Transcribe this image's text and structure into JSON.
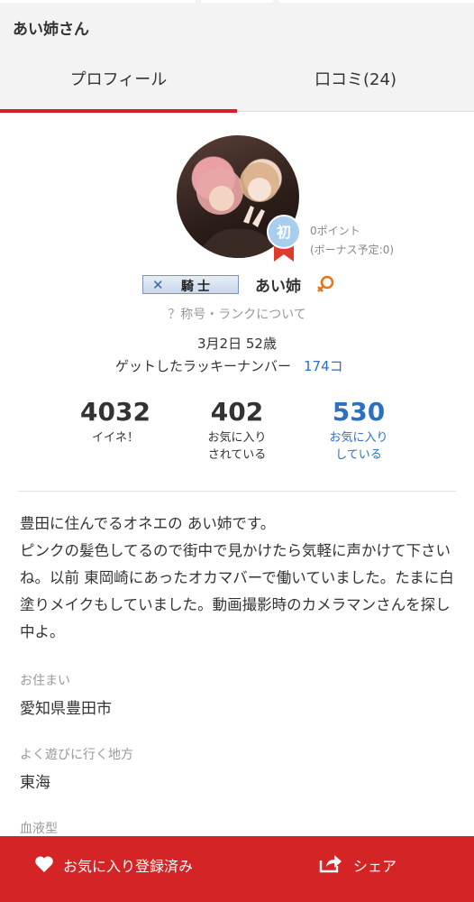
{
  "header": {
    "title": "あい姉さん"
  },
  "tabs": [
    {
      "label": "プロフィール",
      "active": true
    },
    {
      "label": "口コミ(24)",
      "active": false
    }
  ],
  "profile": {
    "beginner_badge": "初",
    "points_line1": "0ポイント",
    "points_line2": "(ボーナス予定:0)",
    "rank_label": "騎士",
    "nickname": "あい姉",
    "gender_icon": "female-icon",
    "rank_help": "？称号・ランクについて",
    "birth_age": "3月2日 52歳",
    "lucky_label": "ゲットしたラッキーナンバー",
    "lucky_value": "174コ"
  },
  "stats": [
    {
      "value": "4032",
      "label_line1": "イイネ！",
      "label_line2": ""
    },
    {
      "value": "402",
      "label_line1": "お気に入り",
      "label_line2": "されている"
    },
    {
      "value": "530",
      "label_line1": "お気に入り",
      "label_line2": "している"
    }
  ],
  "bio": {
    "line1": "豊田に住んでるオネエの あい姉です。",
    "line2": "ピンクの髪色してるので街中で見かけたら気軽に声かけて下さいね。以前 東岡崎にあったオカマバーで働いていました。たまに白塗りメイクもしていました。動画撮影時のカメラマンさんを探し中よ。"
  },
  "fields": {
    "residence_label": "お住まい",
    "residence_value": "愛知県豊田市",
    "area_label": "よく遊びに行く地方",
    "area_value": "東海",
    "blood_label": "血液型"
  },
  "bottom_bar": {
    "favorite_label": "お気に入り登録済み",
    "share_label": "シェア"
  },
  "colors": {
    "accent_red": "#d42425",
    "link_blue": "#2b70c2"
  }
}
